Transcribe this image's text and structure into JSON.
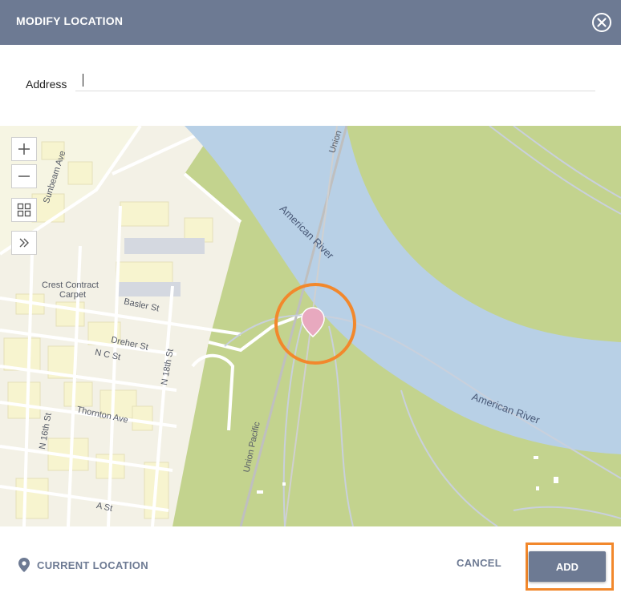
{
  "dialog": {
    "title": "MODIFY LOCATION",
    "close_icon": "close-circle-icon"
  },
  "address": {
    "label": "Address",
    "value": "",
    "placeholder": ""
  },
  "map": {
    "controls": [
      "zoom-in-icon",
      "zoom-out-icon",
      "layers-icon",
      "expand-icon"
    ],
    "labels": {
      "crest_contract": "Crest Contract",
      "carpet": "Carpet",
      "basler": "Basler St",
      "dreher": "Dreher St",
      "nc": "N C St",
      "thornton": "Thornton Ave",
      "n18": "N 18th St",
      "n16": "N 16th St",
      "a_st": "A St",
      "sunbeam": "Sunbeam Ave",
      "union_top": "Union",
      "union_pacific": "Union Pacific",
      "river_upper": "American River",
      "river_lower": "American River"
    },
    "colors": {
      "land": "#c3d38e",
      "urban": "#f5f5dc",
      "water": "#b8d0e6",
      "pin": "#e8a9bf",
      "highlight": "#f2882c"
    }
  },
  "footer": {
    "current_location": "CURRENT LOCATION",
    "cancel": "CANCEL",
    "add": "ADD"
  }
}
